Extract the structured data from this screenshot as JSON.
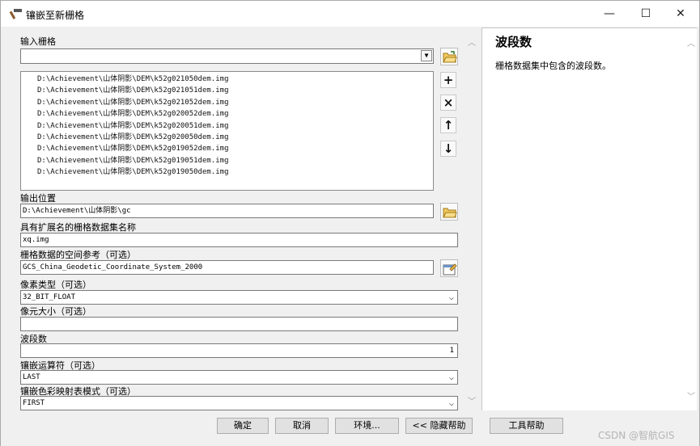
{
  "window": {
    "title": "镶嵌至新栅格",
    "minimize": "—",
    "maximize": "☐",
    "close": "✕",
    "icon": "hammer-icon"
  },
  "form": {
    "input_raster_label": "输入栅格",
    "input_raster_value": "",
    "raster_list": [
      "D:\\Achievement\\山体阴影\\DEM\\k52g021050dem.img",
      "D:\\Achievement\\山体阴影\\DEM\\k52g021051dem.img",
      "D:\\Achievement\\山体阴影\\DEM\\k52g021052dem.img",
      "D:\\Achievement\\山体阴影\\DEM\\k52g020052dem.img",
      "D:\\Achievement\\山体阴影\\DEM\\k52g020051dem.img",
      "D:\\Achievement\\山体阴影\\DEM\\k52g020050dem.img",
      "D:\\Achievement\\山体阴影\\DEM\\k52g019052dem.img",
      "D:\\Achievement\\山体阴影\\DEM\\k52g019051dem.img",
      "D:\\Achievement\\山体阴影\\DEM\\k52g019050dem.img"
    ],
    "output_location_label": "输出位置",
    "output_location_value": "D:\\Achievement\\山体阴影\\gc",
    "dataset_name_label": "具有扩展名的栅格数据集名称",
    "dataset_name_value": "xq.img",
    "spatial_ref_label": "栅格数据的空间参考（可选）",
    "spatial_ref_value": "GCS_China_Geodetic_Coordinate_System_2000",
    "pixel_type_label": "像素类型（可选）",
    "pixel_type_value": "32_BIT_FLOAT",
    "cell_size_label": "像元大小（可选）",
    "cell_size_value": "",
    "bands_label": "波段数",
    "bands_value": "1",
    "mosaic_operator_label": "镶嵌运算符（可选）",
    "mosaic_operator_value": "LAST",
    "colormap_mode_label": "镶嵌色彩映射表模式（可选）",
    "colormap_mode_value": "FIRST"
  },
  "help": {
    "title": "波段数",
    "text": "栅格数据集中包含的波段数。"
  },
  "buttons": {
    "ok": "确定",
    "cancel": "取消",
    "environments": "环境...",
    "hide_help": "<< 隐藏帮助",
    "tool_help": "工具帮助"
  },
  "watermark": "CSDN @智航GIS",
  "icons": {
    "add": "+",
    "remove": "×",
    "up": "↑",
    "down": "↓",
    "dropdown": "▼",
    "chevron_down": "⌵",
    "scroll_up": "︿",
    "scroll_down": "﹀"
  }
}
